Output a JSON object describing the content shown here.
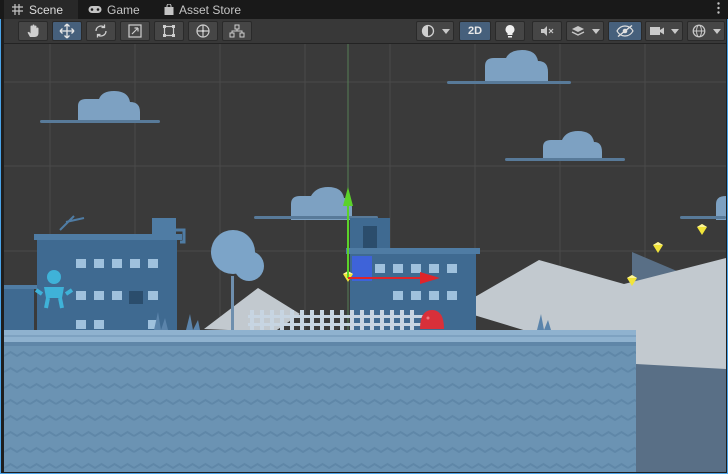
{
  "window": {
    "tabs": [
      {
        "label": "Scene",
        "icon": "grid-icon",
        "active": true
      },
      {
        "label": "Game",
        "icon": "gamepad-icon",
        "active": false
      },
      {
        "label": "Asset Store",
        "icon": "shopping-bag-icon",
        "active": false
      }
    ],
    "menu_icon": "kebab-menu-icon"
  },
  "toolbar": {
    "tools": [
      {
        "name": "hand-tool",
        "icon": "hand-icon",
        "active": false
      },
      {
        "name": "move-tool",
        "icon": "move-arrows-icon",
        "active": true
      },
      {
        "name": "rotate-tool",
        "icon": "rotate-icon",
        "active": false
      },
      {
        "name": "scale-tool",
        "icon": "scale-icon",
        "active": false
      },
      {
        "name": "rect-tool",
        "icon": "rect-tool-icon",
        "active": false
      },
      {
        "name": "transform-tool",
        "icon": "transform-icon",
        "active": false
      },
      {
        "name": "custom-tool",
        "icon": "custom-tools-icon",
        "active": false
      }
    ],
    "view_2d_label": "2D",
    "view_2d_active": true,
    "shading_icon": "draw-mode-icon",
    "lighting_icon": "lightbulb-icon",
    "audio_icon": "audio-muted-icon",
    "effects_icon": "effects-layers-icon",
    "visibility_icon": "hidden-eye-icon",
    "camera_icon": "camera-icon",
    "gizmos_icon": "gizmo-globe-icon"
  },
  "colors": {
    "accent": "#4aa3e8",
    "background": "#383838",
    "sky": "#3a3a3a",
    "ground": "#6e95b5",
    "mountain": "#c2c9cf",
    "gizmo_x": "#e0242a",
    "gizmo_y": "#5bd22a",
    "gem": "#f1e43a"
  }
}
